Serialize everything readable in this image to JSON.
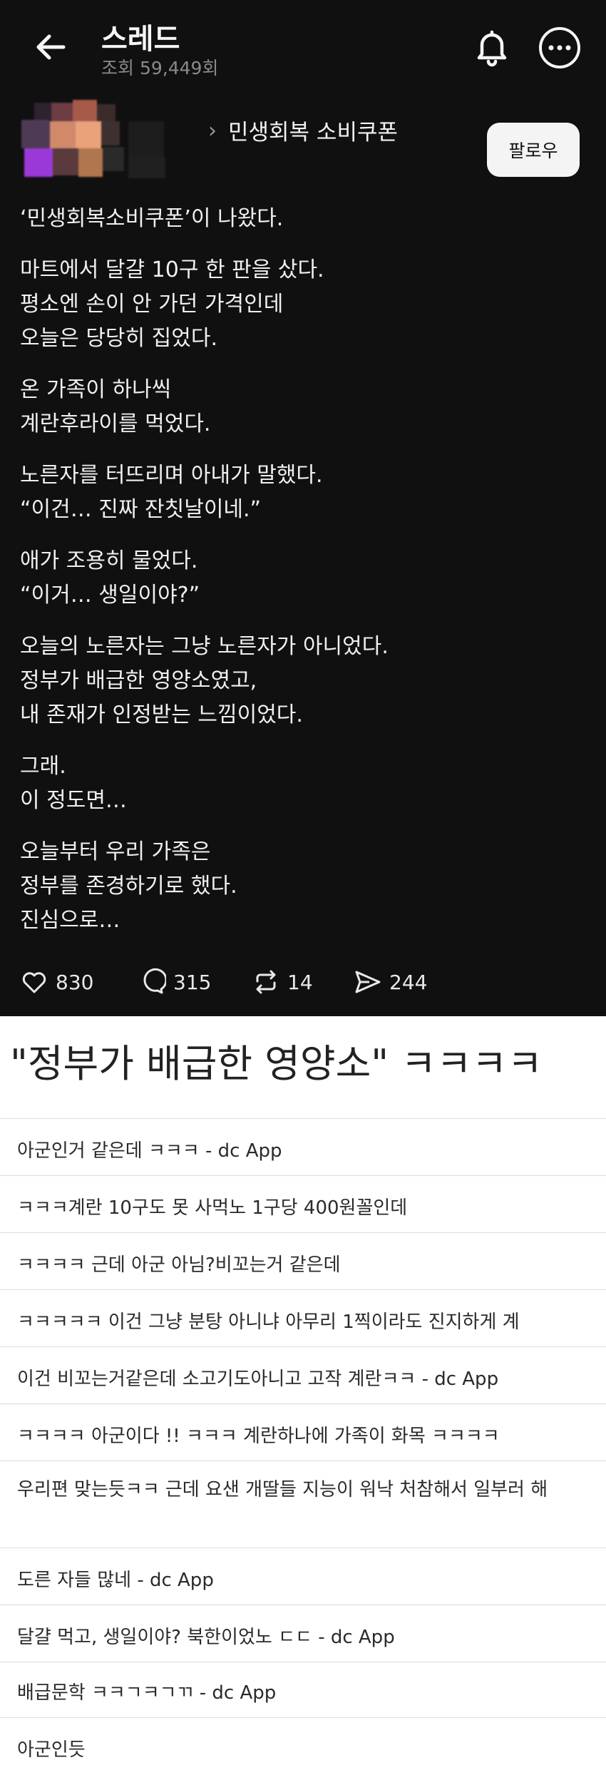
{
  "header": {
    "title": "스레드",
    "views": "조회 59,449회"
  },
  "post": {
    "group_name": "민생회복 소비쿠폰",
    "follow_label": "팔로우",
    "paragraphs": [
      [
        "‘민생회복소비쿠폰’이 나왔다."
      ],
      [
        "마트에서 달걀 10구 한 판을 샀다.",
        "평소엔 손이 안 가던 가격인데",
        "오늘은 당당히 집었다."
      ],
      [
        "온 가족이 하나씩",
        "계란후라이를 먹었다."
      ],
      [
        "노른자를 터뜨리며 아내가 말했다.",
        "“이건… 진짜 잔칫날이네.”"
      ],
      [
        "애가 조용히 물었다.",
        "“이거… 생일이야?”"
      ],
      [
        "오늘의 노른자는 그냥 노른자가 아니었다.",
        "정부가 배급한 영양소였고,",
        "내 존재가 인정받는 느낌이었다."
      ],
      [
        "그래.",
        "이 정도면…"
      ],
      [
        "오늘부터 우리 가족은",
        "정부를 존경하기로 했다.",
        "진심으로…"
      ]
    ],
    "stats": {
      "likes": "830",
      "comments": "315",
      "reposts": "14",
      "shares": "244"
    }
  },
  "comments_section": {
    "headline": "\"정부가 배급한 영양소\" ㅋㅋㅋㅋ",
    "comments": [
      "아군인거 같은데 ㅋㅋㅋ - dc App",
      "ㅋㅋㅋ계란 10구도 못 사먹노 1구당 400원꼴인데",
      "ㅋㅋㅋㅋ 근데 아군 아님?비꼬는거 같은데",
      "ㅋㅋㅋㅋㅋ 이건 그냥 분탕 아니냐 아무리 1찍이라도 진지하게 계",
      "이건 비꼬는거같은데 소고기도아니고 고작 계란ㅋㅋ - dc App",
      "ㅋㅋㅋㅋ 아군이다 !! ㅋㅋㅋ 계란하나에 가족이 화목 ㅋㅋㅋㅋ",
      "우리편 맞는듯ㅋㅋ 근데 요샌 개딸들 지능이 워낙 처참해서 일부러 해",
      "도른 자들 많네 - dc App",
      "달걀 먹고, 생일이야? 북한이었노 ㄷㄷ - dc App",
      "배급문학 ㅋㅋㄱㅋㄱㄲ - dc App",
      "아군인듯"
    ]
  },
  "icons": {
    "back": "arrow-left-icon",
    "bell": "bell-icon",
    "more": "more-horizontal-icon",
    "like": "heart-icon",
    "comment": "comment-bubble-icon",
    "repost": "repost-icon",
    "share": "send-icon"
  },
  "colors": {
    "thread_bg": "#101010",
    "text_light": "#f2f2f2",
    "muted": "#8a8a8a",
    "follow_bg": "#f4f4f4",
    "comments_bg": "#ffffff"
  }
}
